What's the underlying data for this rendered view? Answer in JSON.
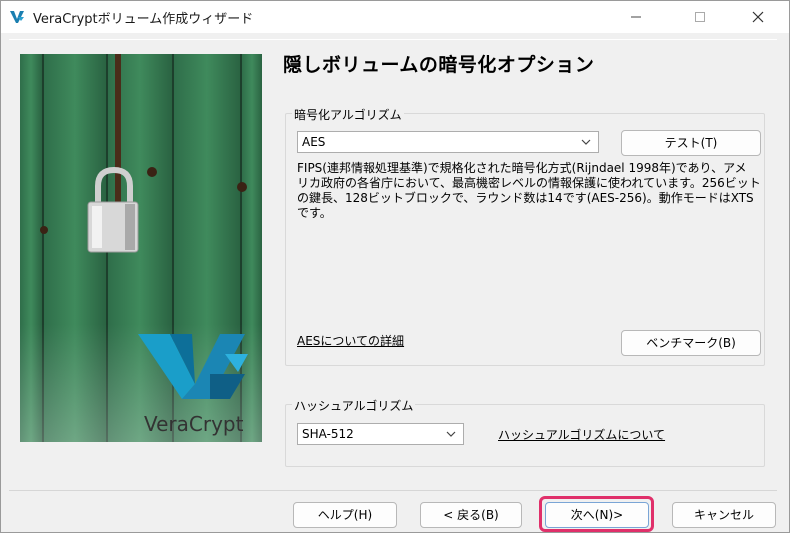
{
  "window": {
    "title": "VeraCryptボリューム作成ウィザード",
    "min_label": "—",
    "max_label": "☐",
    "close_label": "✕"
  },
  "sidebar": {
    "brand": "VeraCrypt",
    "brand_color": "#1a9ec9"
  },
  "page": {
    "title": "隠しボリュームの暗号化オプション"
  },
  "encryption": {
    "group_label": "暗号化アルゴリズム",
    "selected": "AES",
    "test_button": "テスト(T)",
    "description_line1": "FIPS(連邦情報処理基準)で規格化された暗号化方式(Rijndael 1998年)であり、アメ",
    "description_line2": "リカ政府の各省庁において、最高機密レベルの情報保護に使われています。256ビット",
    "description_line3": "の鍵長、128ビットブロックで、ラウンド数は14です(AES-256)。動作モードはXTSです。",
    "details_link": "AESについての詳細",
    "benchmark_button": "ベンチマーク(B)"
  },
  "hash": {
    "group_label": "ハッシュアルゴリズム",
    "selected": "SHA-512",
    "about_link": "ハッシュアルゴリズムについて"
  },
  "footer": {
    "help_button": "ヘルプ(H)",
    "back_button": "< 戻る(B)",
    "next_button": "次へ(N)>",
    "cancel_button": "キャンセル",
    "highlight_color": "#e0306a"
  }
}
